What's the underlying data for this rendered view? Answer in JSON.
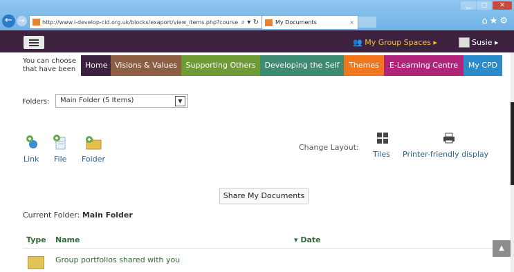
{
  "browser": {
    "url": "http://www.i-develop-cid.org.uk/blocks/exaport/view_items.php?course",
    "tab_title": "My Documents",
    "tab_close": "×",
    "addr_controls": "⌕ ▾ ↻",
    "back": "←",
    "forward": "→",
    "tools": "⌂★⚙"
  },
  "topbar": {
    "group_spaces": "My Group Spaces ▸",
    "user": "Susie ▸"
  },
  "intro_text": "You can choose that have been",
  "nav_tabs": [
    {
      "label": "Home",
      "color": "#3d2240"
    },
    {
      "label": "Visions & Values",
      "color": "#8c5e44"
    },
    {
      "label": "Supporting Others",
      "color": "#6f9b35"
    },
    {
      "label": "Developing the Self",
      "color": "#3f8a73"
    },
    {
      "label": "Themes",
      "color": "#f2761b"
    },
    {
      "label": "E-Learning Centre",
      "color": "#b0247a"
    },
    {
      "label": "My CPD",
      "color": "#2b8ac9"
    }
  ],
  "folders": {
    "label": "Folders:",
    "selected": "Main Folder (5 Items)"
  },
  "actions": {
    "link": "Link",
    "file": "File",
    "folder": "Folder"
  },
  "layout": {
    "change_label": "Change Layout:",
    "tiles": "Tiles",
    "printer": "Printer-friendly display"
  },
  "share_button": "Share My Documents",
  "current_folder": {
    "label": "Current Folder:",
    "name": "Main Folder"
  },
  "table": {
    "headers": [
      "Type",
      "Name",
      "▾ Date"
    ],
    "rows": [
      {
        "name": "Group portfolios shared with you"
      }
    ]
  },
  "icons": [
    "back-icon",
    "home-icon",
    "star-icon",
    "gear-icon",
    "menu-icon",
    "group-icon",
    "avatar-icon",
    "link-icon",
    "file-icon",
    "folder-icon",
    "tiles-icon",
    "printer-icon",
    "scroll-top-icon"
  ]
}
